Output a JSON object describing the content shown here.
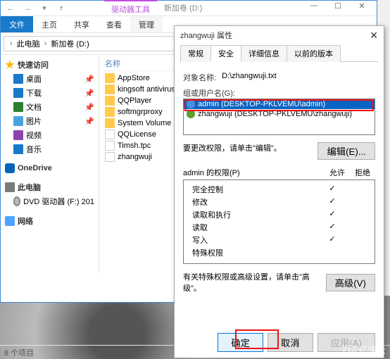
{
  "explorer": {
    "ribbon_context_label": "驱动器工具",
    "ribbon_context_tab": "新加卷 (D:)",
    "file_tab": "文件",
    "tabs": [
      "主页",
      "共享",
      "查看",
      "管理"
    ],
    "breadcrumb": {
      "pc": "此电脑",
      "vol": "新加卷 (D:)"
    },
    "nav": {
      "quick": "快速访问",
      "desktop": "桌面",
      "downloads": "下载",
      "documents": "文档",
      "pictures": "图片",
      "videos": "视频",
      "music": "音乐",
      "onedrive": "OneDrive",
      "thispc": "此电脑",
      "dvd": "DVD 驱动器 (F:) 201",
      "network": "网络"
    },
    "cols": {
      "name": "名称"
    },
    "files": [
      {
        "name": "AppStore",
        "type": "folder"
      },
      {
        "name": "kingsoft antivirus",
        "type": "folder"
      },
      {
        "name": "QQPlayer",
        "type": "folder"
      },
      {
        "name": "softmgrproxy",
        "type": "folder"
      },
      {
        "name": "System Volume Information",
        "type": "folder"
      },
      {
        "name": "QQLicense",
        "type": "file"
      },
      {
        "name": "Timsh.tpc",
        "type": "file"
      },
      {
        "name": "zhangwuji",
        "type": "file"
      }
    ],
    "status": "8 个项目"
  },
  "props": {
    "title": "zhangwuji 属性",
    "tabs": {
      "general": "常规",
      "security": "安全",
      "details": "详细信息",
      "prev": "以前的版本"
    },
    "obj_label": "对象名称:",
    "obj_value": "D:\\zhangwuji.txt",
    "group_label": "组或用户名(G):",
    "users": [
      "admin (DESKTOP-PKLVEMU\\admin)",
      "zhangwuji (DESKTOP-PKLVEMU\\zhangwuji)"
    ],
    "edit_hint": "要更改权限，请单击\"编辑\"。",
    "edit_btn": "编辑(E)...",
    "perm_label": "admin 的权限(P)",
    "col_allow": "允许",
    "col_deny": "拒绝",
    "perms": [
      {
        "name": "完全控制",
        "allow": true
      },
      {
        "name": "修改",
        "allow": true
      },
      {
        "name": "读取和执行",
        "allow": true
      },
      {
        "name": "读取",
        "allow": true
      },
      {
        "name": "写入",
        "allow": true
      },
      {
        "name": "特殊权限",
        "allow": false
      }
    ],
    "adv_hint": "有关特殊权限或高级设置，请单击\"高级\"。",
    "adv_btn": "高级(V)",
    "ok": "确定",
    "cancel": "取消",
    "apply": "应用(A)"
  },
  "watermark": "亿速云"
}
